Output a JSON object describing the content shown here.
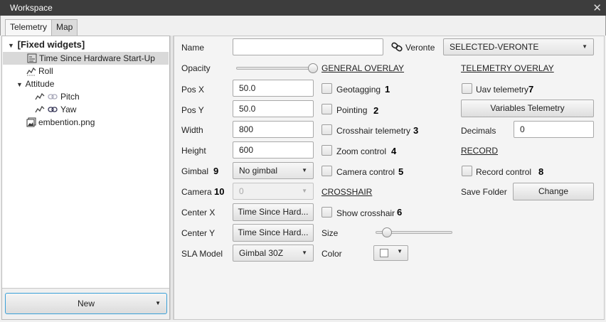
{
  "window": {
    "title": "Workspace"
  },
  "tabs": [
    {
      "label": "Telemetry"
    },
    {
      "label": "Map"
    }
  ],
  "tree": {
    "root": "[Fixed widgets]",
    "items": [
      "Time Since Hardware Start-Up",
      "Roll",
      "Attitude",
      "Pitch",
      "Yaw",
      "embention.png"
    ]
  },
  "new_button": {
    "label": "New"
  },
  "form": {
    "name_label": "Name",
    "name_value": "",
    "veronte_label": "Veronte",
    "veronte_value": "SELECTED-VERONTE",
    "opacity_label": "Opacity",
    "opacity_value": 1.0,
    "posx_label": "Pos X",
    "posx_value": "50.0",
    "posy_label": "Pos Y",
    "posy_value": "50.0",
    "width_label": "Width",
    "width_value": "800",
    "height_label": "Height",
    "height_value": "600",
    "gimbal_label": "Gimbal",
    "gimbal_value": "No gimbal",
    "camera_label": "Camera",
    "camera_value": "0",
    "centerx_label": "Center X",
    "centerx_value": "Time Since Hard...",
    "centery_label": "Center Y",
    "centery_value": "Time Since Hard...",
    "sla_label": "SLA Model",
    "sla_value": "Gimbal 30Z"
  },
  "general_overlay": {
    "header": "GENERAL OVERLAY",
    "geotagging": "Geotagging",
    "pointing": "Pointing",
    "crosshair_telemetry": "Crosshair telemetry",
    "zoom_control": "Zoom control",
    "camera_control": "Camera control"
  },
  "crosshair": {
    "header": "CROSSHAIR",
    "show_crosshair": "Show crosshair",
    "size_label": "Size",
    "size_value": 0.15,
    "color_label": "Color"
  },
  "telemetry_overlay": {
    "header": "TELEMETRY OVERLAY",
    "uav_telemetry": "Uav telemetry",
    "variables_button": "Variables Telemetry",
    "decimals_label": "Decimals",
    "decimals_value": "0"
  },
  "record": {
    "header": "RECORD",
    "record_control": "Record control",
    "save_folder_label": "Save Folder",
    "change_button": "Change"
  },
  "annotations": [
    "1",
    "2",
    "3",
    "4",
    "5",
    "6",
    "7",
    "8",
    "9",
    "10"
  ],
  "colors": {
    "accent": "#3aa0d8",
    "titlebar": "#3d3d3d"
  }
}
